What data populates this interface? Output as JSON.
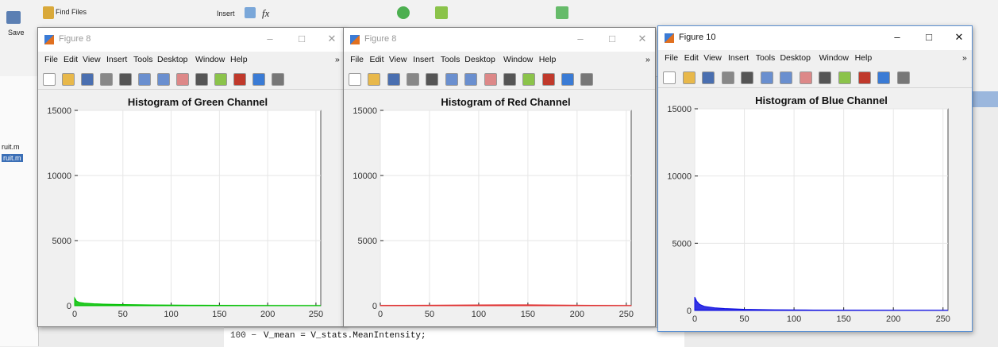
{
  "ribbon": {
    "find_files": "Find Files",
    "insert": "Insert",
    "fx": "fx",
    "save": "Save"
  },
  "file_browser": {
    "items": [
      "ruit.m",
      "ruit.m"
    ]
  },
  "editor": {
    "line_number": "100 −",
    "code": "V_mean = V_stats.MeanIntensity;"
  },
  "menus": [
    "File",
    "Edit",
    "View",
    "Insert",
    "Tools",
    "Desktop",
    "Window",
    "Help"
  ],
  "figures": [
    {
      "title": "Figure 8",
      "active": false,
      "color": "#00c000"
    },
    {
      "title": "Figure 8",
      "active": false,
      "color": "#e03030"
    },
    {
      "title": "Figure 10",
      "active": true,
      "color": "#1010e0"
    }
  ],
  "chart_data": [
    {
      "type": "area",
      "title": "Histogram of Green Channel",
      "xlim": [
        0,
        255
      ],
      "ylim": [
        0,
        15000
      ],
      "xticks": [
        0,
        50,
        100,
        150,
        200,
        250
      ],
      "yticks": [
        0,
        5000,
        10000,
        15000
      ],
      "grid": true,
      "series": [
        {
          "color": "#00c000",
          "x": [
            0,
            2,
            5,
            10,
            20,
            30,
            50,
            80,
            120,
            150,
            200,
            255
          ],
          "y": [
            600,
            350,
            250,
            200,
            150,
            120,
            90,
            60,
            40,
            30,
            10,
            0
          ]
        }
      ]
    },
    {
      "type": "area",
      "title": "Histogram of Red Channel",
      "xlim": [
        0,
        255
      ],
      "ylim": [
        0,
        15000
      ],
      "xticks": [
        0,
        50,
        100,
        150,
        200,
        250
      ],
      "yticks": [
        0,
        5000,
        10000,
        15000
      ],
      "grid": true,
      "series": [
        {
          "color": "#e03030",
          "x": [
            0,
            20,
            50,
            100,
            150,
            200,
            255
          ],
          "y": [
            20,
            30,
            40,
            60,
            70,
            40,
            10
          ]
        }
      ]
    },
    {
      "type": "area",
      "title": "Histogram of Blue Channel",
      "xlim": [
        0,
        255
      ],
      "ylim": [
        0,
        15000
      ],
      "xticks": [
        0,
        50,
        100,
        150,
        200,
        250
      ],
      "yticks": [
        0,
        5000,
        10000,
        15000
      ],
      "grid": true,
      "series": [
        {
          "color": "#1010e0",
          "x": [
            0,
            2,
            5,
            10,
            20,
            30,
            50,
            80,
            120,
            200,
            255
          ],
          "y": [
            1000,
            700,
            450,
            300,
            200,
            150,
            90,
            50,
            30,
            10,
            0
          ]
        }
      ]
    }
  ]
}
